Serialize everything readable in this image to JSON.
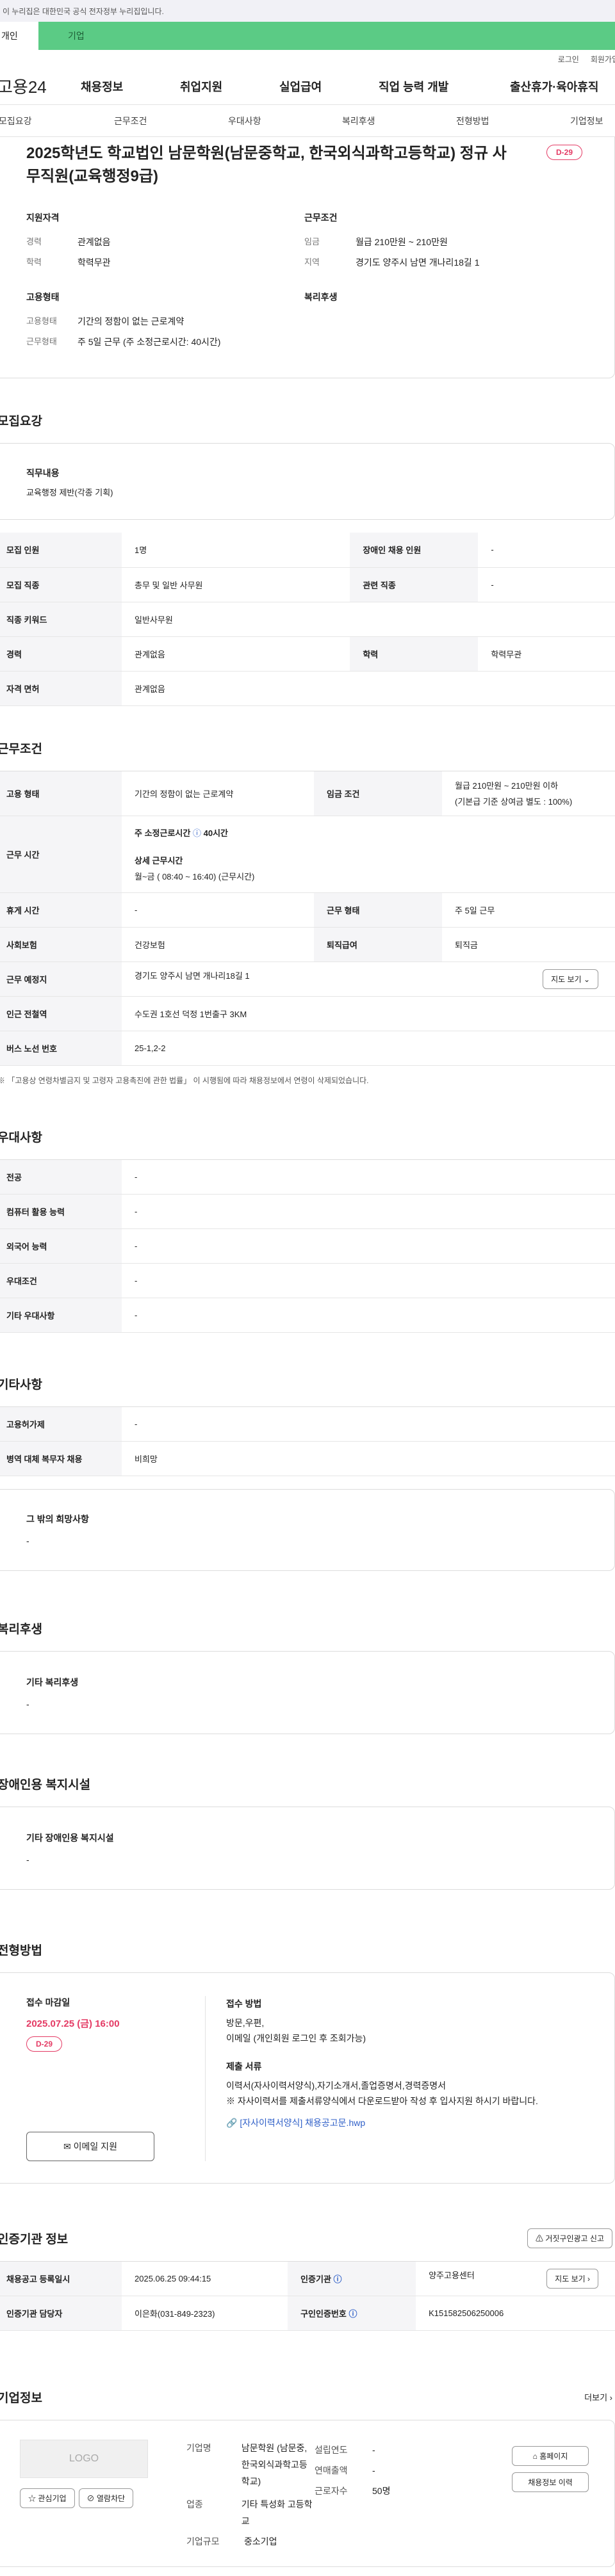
{
  "gov_banner": "이 누리집은 대한민국 공식 전자정부 누리집입니다.",
  "tabs": {
    "personal": "개인",
    "company": "기업"
  },
  "utility": {
    "login": "로그인",
    "signup": "회원가입"
  },
  "gnb": {
    "logo": "고용24",
    "items": [
      "채용정보",
      "취업지원",
      "실업급여",
      "직업 능력 개발",
      "출산휴가·육아휴직"
    ]
  },
  "subnav": [
    "모집요강",
    "근무조건",
    "우대사항",
    "복리후생",
    "전형방법",
    "기업정보"
  ],
  "summary": {
    "title": "2025학년도 학교법인 남문학원(남문중학교, 한국외식과학고등학교) 정규 사무직원(교육행정9급)",
    "dday": "D-29",
    "qual_h": "지원자격",
    "cond_h": "근무조건",
    "emp_h": "고용형태",
    "welfare_h": "복리후생",
    "career_l": "경력",
    "career_v": "관계없음",
    "edu_l": "학력",
    "edu_v": "학력무관",
    "wage_l": "임금",
    "wage_v": "월급 210만원 ~ 210만원",
    "region_l": "지역",
    "region_v": "경기도 양주시 남면 개나리18길 1",
    "emptype_l": "고용형태",
    "emptype_v": "기간의 정함이 없는 근로계약",
    "worktype_l": "근무형태",
    "worktype_v": "주 5일 근무 (주 소정근로시간: 40시간)"
  },
  "recruit": {
    "title": "모집요강",
    "duty_h": "직무내용",
    "duty_v": "교육행정 제반(각종 기획)",
    "rows": [
      [
        "모집 인원",
        "1명",
        "장애인 채용 인원",
        "-"
      ],
      [
        "모집 직종",
        "총무 및 일반 사무원",
        "관련 직종",
        "-"
      ],
      [
        "직종 키워드",
        "일반사무원",
        "",
        ""
      ],
      [
        "경력",
        "관계없음",
        "학력",
        "학력무관"
      ],
      [
        "자격 면허",
        "관계없음",
        "",
        ""
      ]
    ]
  },
  "conditions": {
    "title": "근무조건",
    "emp_l": "고용 형태",
    "emp_v": "기간의 정함이 없는 근로계약",
    "wage_l": "임금 조건",
    "wage_v1": "월급 210만원 ~ 210만원 이하",
    "wage_v2": "(기본급 기준 상여금 별도 : 100%)",
    "hours_l": "근무 시간",
    "hours_a": "주 소정근로시간",
    "hours_b": "40시간",
    "hours_c": "상세 근무시간",
    "hours_d": "월~금 ( 08:40 ~ 16:40) (근무시간)",
    "rest_l": "휴게 시간",
    "rest_v": "-",
    "form_l": "근무 형태",
    "form_v": "주 5일 근무",
    "ins_l": "사회보험",
    "ins_v": "건강보험",
    "ret_l": "퇴직급여",
    "ret_v": "퇴직금",
    "place_l": "근무 예정지",
    "place_v": "경기도 양주시 남면 개나리18길 1",
    "map_btn": "지도 보기",
    "sub_l": "인근 전철역",
    "sub_v": "수도권 1호선 덕정 1번출구 3KM",
    "bus_l": "버스 노선 번호",
    "bus_v": "25-1,2-2",
    "note": "※ 「고용상 연령차별금지 및 고령자 고용촉진에 관한 법률」 이 시행됨에 따라 채용정보에서 연령이 삭제되었습니다."
  },
  "prefer": {
    "title": "우대사항",
    "rows": [
      [
        "전공",
        "-"
      ],
      [
        "컴퓨터 활용 능력",
        "-"
      ],
      [
        "외국어 능력",
        "-"
      ],
      [
        "우대조건",
        "-"
      ],
      [
        "기타 우대사항",
        "-"
      ]
    ]
  },
  "etc": {
    "title": "기타사항",
    "rows": [
      [
        "고용허가제",
        "-"
      ],
      [
        "병역 대체 복무자 채용",
        "비희망"
      ]
    ],
    "hope_h": "그 밖의 희망사항",
    "hope_v": "-"
  },
  "welfare": {
    "title": "복리후생",
    "h": "기타 복리후생",
    "v": "-"
  },
  "disabled": {
    "title": "장애인용 복지시설",
    "h": "기타 장애인용 복지시설",
    "v": "-"
  },
  "process": {
    "title": "전형방법",
    "deadline_h": "접수 마감일",
    "deadline_v": "2025.07.25 (금) 16:00",
    "dday": "D-29",
    "email_btn": "이메일 지원",
    "method_h": "접수 방법",
    "method_v1": "방문,우편,",
    "method_v2": "이메일 (개인회원 로그인 후 조회가능)",
    "docs_h": "제출 서류",
    "docs_v1": "이력서(자사이력서양식),자기소개서,졸업증명서,경력증명서",
    "docs_v2": "※ 자사이력서를 제출서류양식에서 다운로드받아 작성 후 입사지원 하시기 바랍니다.",
    "file": "[자사이력서양식] 채용공고문.hwp"
  },
  "agency": {
    "title": "인증기관 정보",
    "report_btn": "거짓구인광고 신고",
    "reg_l": "채용공고 등록일시",
    "reg_v": "2025.06.25 09:44:15",
    "org_l": "인증기관",
    "org_v": "양주고용센터",
    "map_btn": "지도 보기",
    "mgr_l": "인증기관 담당자",
    "mgr_v": "이은화(031-849-2323)",
    "num_l": "구인인증번호",
    "num_v": "K151582506250006"
  },
  "company": {
    "title": "기업정보",
    "more": "더보기",
    "logo": "LOGO",
    "fav": "관심기업",
    "block": "열람차단",
    "name_l": "기업명",
    "name_v": "남문학원 (남문중, 한국외식과학고등학교)",
    "ind_l": "업종",
    "ind_v": "기타 특성화 고등학교",
    "size_l": "기업규모",
    "size_v": "중소기업",
    "year_l": "설립연도",
    "year_v": "-",
    "sales_l": "연매출액",
    "sales_v": "-",
    "emp_l": "근로자수",
    "emp_v": "50명",
    "home_btn": "홈페이지",
    "all_btn": "채용정보 이력"
  }
}
